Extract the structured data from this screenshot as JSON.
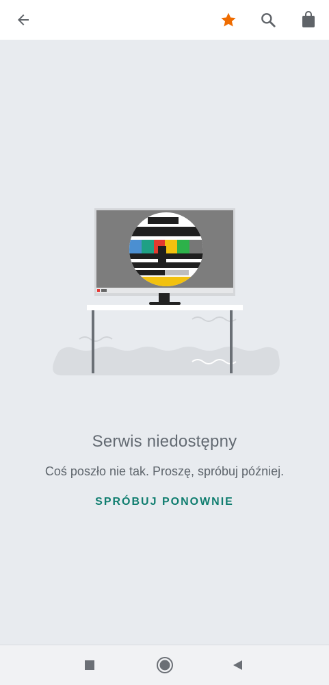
{
  "toolbar": {
    "back_icon": "arrow-left-icon",
    "favorite_icon": "star-icon",
    "favorite_color": "#ef6c00",
    "search_icon": "search-icon",
    "bag_icon": "shopping-bag-icon"
  },
  "error": {
    "title": "Serwis niedostępny",
    "message": "Coś poszło nie tak. Proszę, spróbuj później.",
    "retry_label": "SPRÓBUJ PONOWNIE"
  },
  "colors": {
    "background": "#e8ebef",
    "accent": "#0f7d6f"
  },
  "navbar": {
    "recent_icon": "square-icon",
    "home_icon": "circle-icon",
    "back_icon": "triangle-back-icon"
  }
}
